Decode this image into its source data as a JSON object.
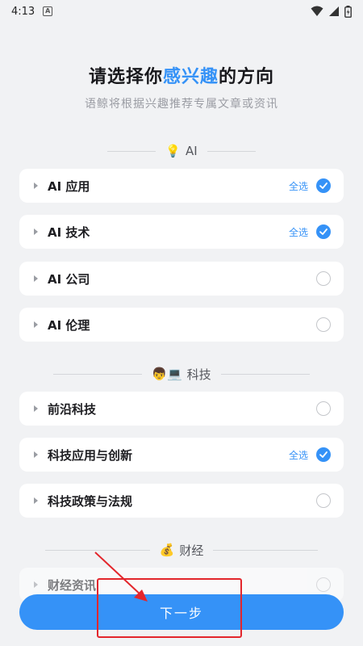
{
  "status_bar": {
    "time": "4:13",
    "notification_icon": "A"
  },
  "header": {
    "title_prefix": "请选择你",
    "title_highlight": "感兴趣",
    "title_suffix": "的方向",
    "subtitle": "语鲸将根据兴趣推荐专属文章或资讯"
  },
  "sections": [
    {
      "emoji": "💡",
      "label": "AI",
      "items": [
        {
          "name": "AI 应用",
          "select_all": "全选",
          "checked": true
        },
        {
          "name": "AI 技术",
          "select_all": "全选",
          "checked": true
        },
        {
          "name": "AI 公司",
          "checked": false
        },
        {
          "name": "AI 伦理",
          "checked": false
        }
      ]
    },
    {
      "emoji": "👦💻",
      "label": "科技",
      "items": [
        {
          "name": "前沿科技",
          "checked": false
        },
        {
          "name": "科技应用与创新",
          "select_all": "全选",
          "checked": true
        },
        {
          "name": "科技政策与法规",
          "checked": false
        }
      ]
    },
    {
      "emoji": "💰",
      "label": "财经",
      "items": [
        {
          "name": "财经资讯",
          "checked": false
        }
      ]
    }
  ],
  "next_button": {
    "label": "下一步"
  },
  "colors": {
    "accent": "#3592f7",
    "annotation": "#e3262c"
  }
}
